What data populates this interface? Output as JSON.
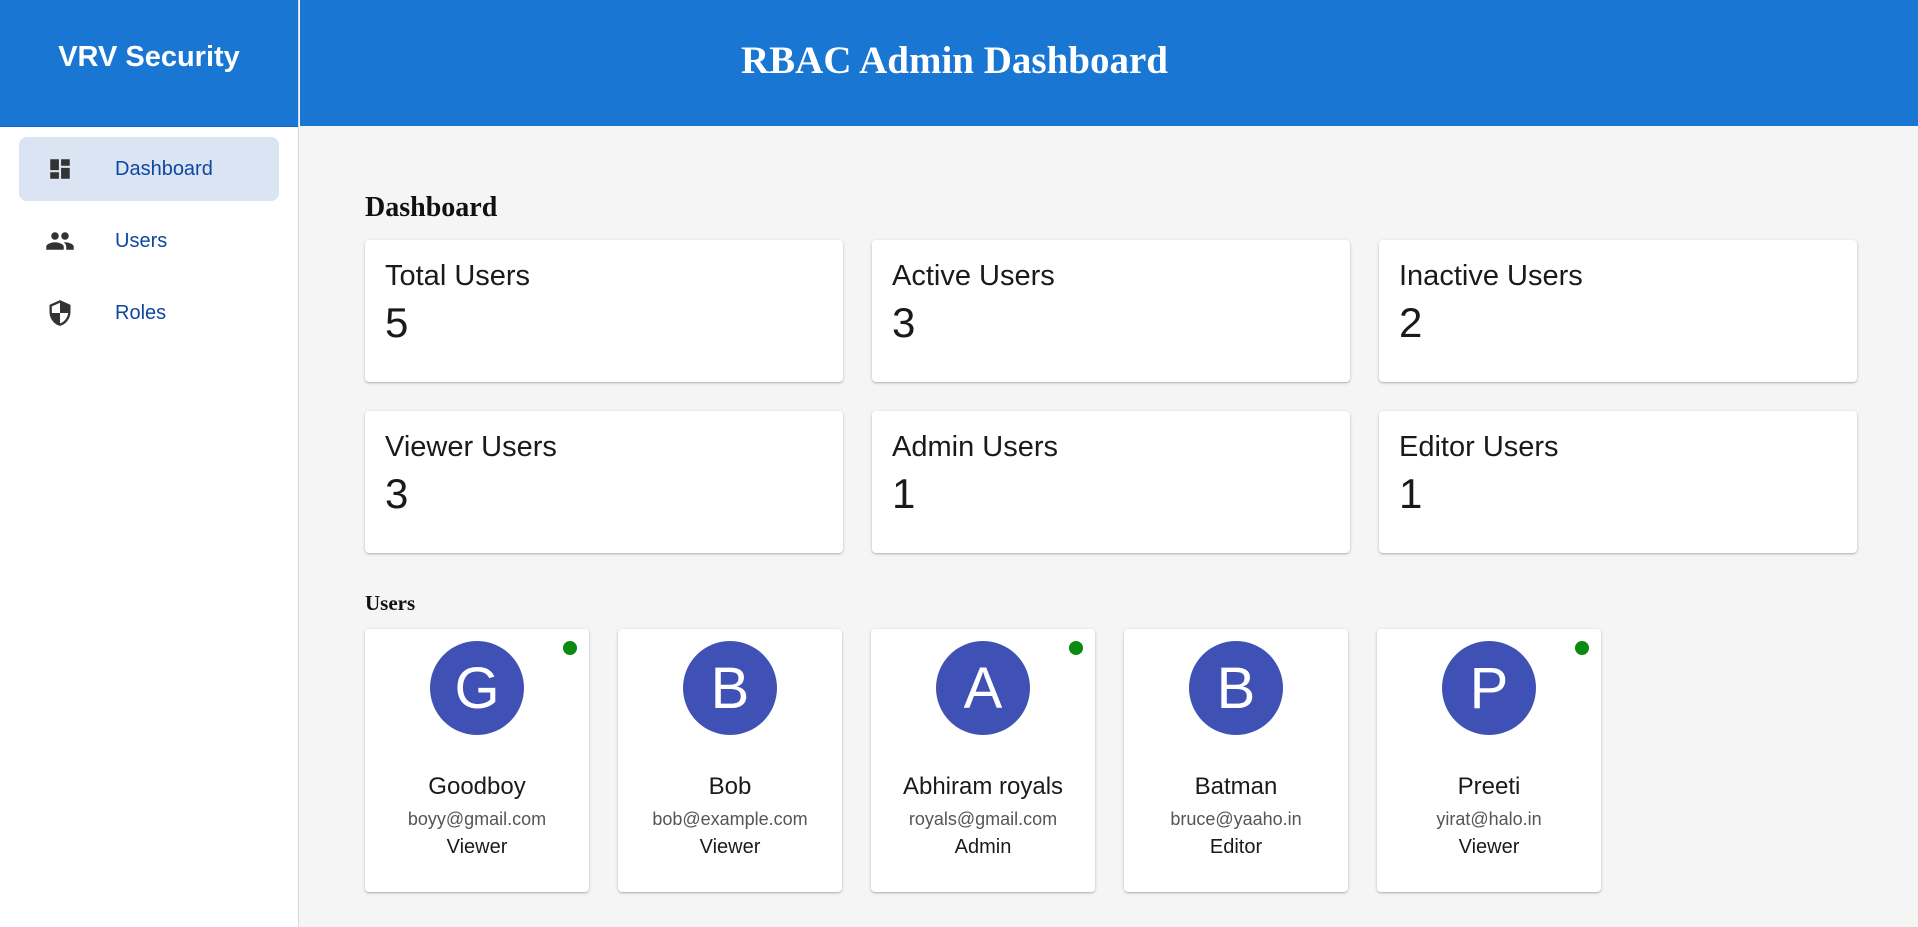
{
  "brand": {
    "name": "VRV Security"
  },
  "header": {
    "title": "RBAC Admin Dashboard"
  },
  "sidebar": {
    "items": [
      {
        "label": "Dashboard",
        "icon": "dashboard-icon",
        "active": true
      },
      {
        "label": "Users",
        "icon": "people-icon",
        "active": false
      },
      {
        "label": "Roles",
        "icon": "shield-icon",
        "active": false
      }
    ]
  },
  "main": {
    "section_title": "Dashboard",
    "stats": [
      {
        "label": "Total Users",
        "value": "5"
      },
      {
        "label": "Active Users",
        "value": "3"
      },
      {
        "label": "Inactive Users",
        "value": "2"
      },
      {
        "label": "Viewer Users",
        "value": "3"
      },
      {
        "label": "Admin Users",
        "value": "1"
      },
      {
        "label": "Editor Users",
        "value": "1"
      }
    ],
    "users_title": "Users",
    "users": [
      {
        "initial": "G",
        "name": "Goodboy",
        "email": "boyy@gmail.com",
        "role": "Viewer",
        "active": true
      },
      {
        "initial": "B",
        "name": "Bob",
        "email": "bob@example.com",
        "role": "Viewer",
        "active": false
      },
      {
        "initial": "A",
        "name": "Abhiram royals",
        "email": "royals@gmail.com",
        "role": "Admin",
        "active": true
      },
      {
        "initial": "B",
        "name": "Batman",
        "email": "bruce@yaaho.in",
        "role": "Editor",
        "active": false
      },
      {
        "initial": "P",
        "name": "Preeti",
        "email": "yirat@halo.in",
        "role": "Viewer",
        "active": true
      }
    ]
  },
  "colors": {
    "primary": "#1976d2",
    "avatar": "#3f51b5",
    "active_dot": "#0b8a12",
    "nav_active_bg": "#dbe4f3",
    "nav_text": "#0d47a1"
  }
}
